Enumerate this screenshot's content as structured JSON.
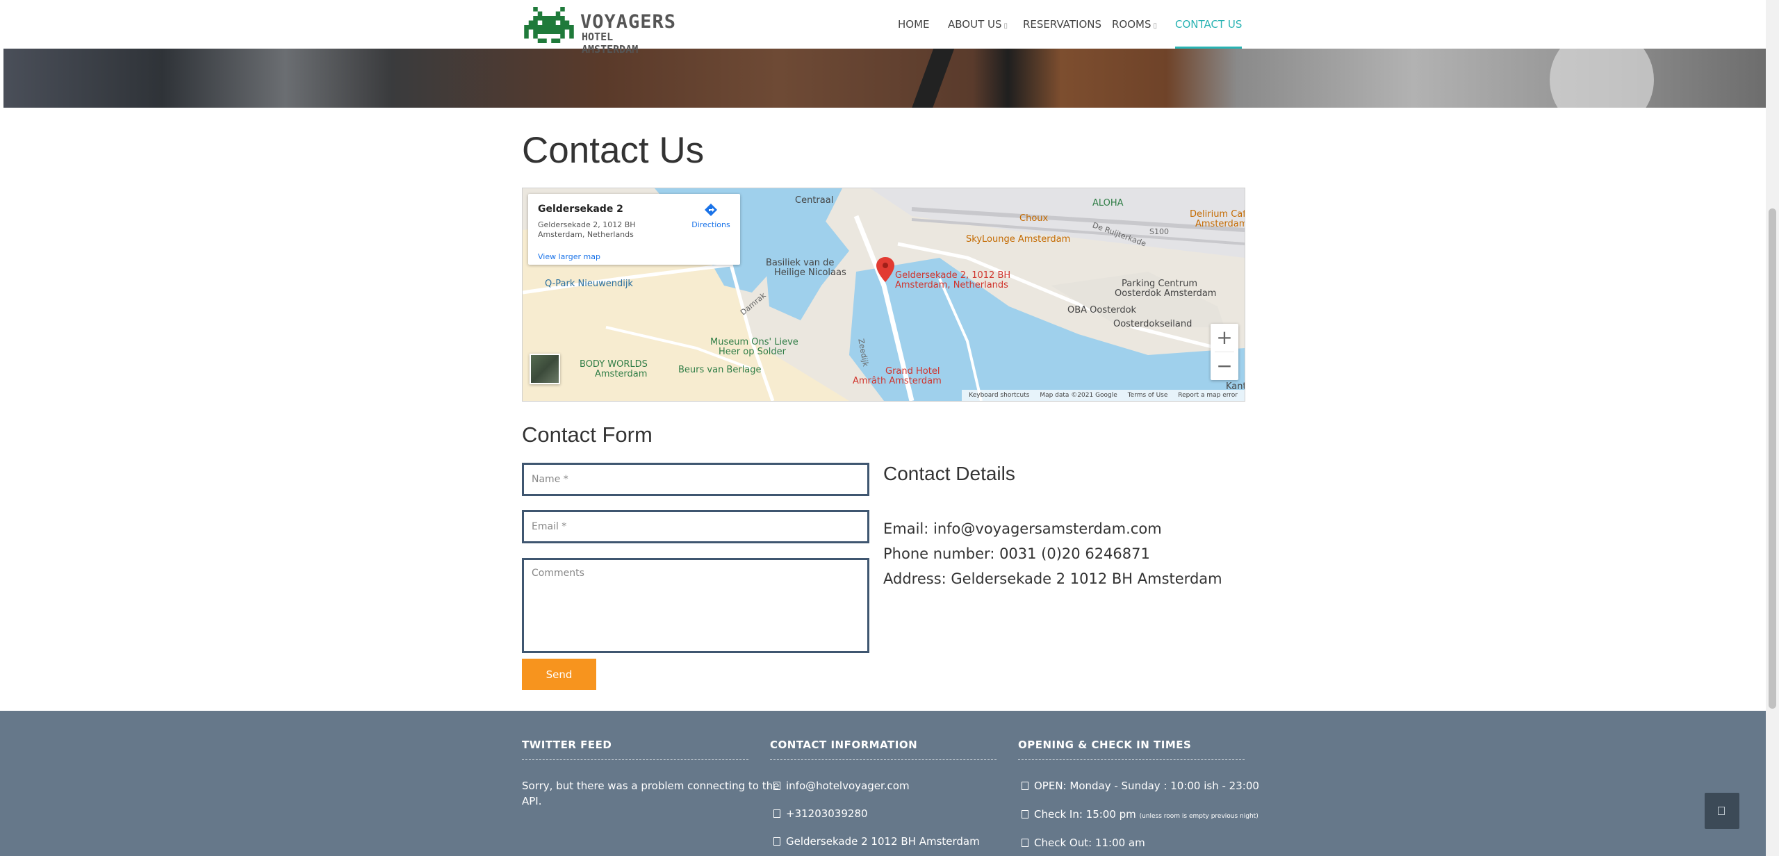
{
  "brand": {
    "name": "VOYAGERS",
    "subtitle": "HOTEL AMSTERDAM"
  },
  "nav": {
    "items": [
      {
        "label": "HOME",
        "caret": ""
      },
      {
        "label": "ABOUT US",
        "caret": "▯"
      },
      {
        "label": "RESERVATIONS",
        "caret": ""
      },
      {
        "label": "ROOMS",
        "caret": "▯"
      },
      {
        "label": "CONTACT US",
        "caret": ""
      }
    ],
    "active_label": "CONTACT US",
    "accent_color": "#29b3b3"
  },
  "page": {
    "title": "Contact Us"
  },
  "map": {
    "card": {
      "title": "Geldersekade 2",
      "address": "Geldersekade 2, 1012 BH Amsterdam, Netherlands",
      "larger_map": "View larger map",
      "directions": "Directions"
    },
    "pin_label_1": "Geldersekade 2, 1012 BH",
    "pin_label_2": "Amsterdam, Netherlands",
    "places": {
      "centraal": "Centraal",
      "aloha": "ALOHA",
      "choux": "Choux",
      "delirium": "Delirium Café",
      "delirium2": "Amsterdam",
      "skylounge": "SkyLounge Amsterdam",
      "basiliek1": "Basiliek van de",
      "basiliek2": "Heilige Nicolaas",
      "qpark": "Q-Park Nieuwendijk",
      "parking1": "Parking Centrum",
      "parking2": "Oosterdok Amsterdam",
      "oba": "OBA Oosterdok",
      "oosterdokseiland": "Oosterdokseiland",
      "museum1": "Museum Ons' Lieve",
      "museum2": "Heer op Solder",
      "bodyworlds1": "BODY WORLDS",
      "bodyworlds2": "Amsterdam",
      "beurs": "Beurs van Berlage",
      "grandhotel1": "Grand Hotel",
      "grandhotel2": "Amrâth Amsterdam",
      "damrak": "Damrak",
      "debuiksloot": "De Ruijterkade",
      "s100": "S100",
      "zeedijk": "Zeedijk",
      "kant": "Kant"
    },
    "zoom_in": "+",
    "zoom_out": "−",
    "attribution": {
      "shortcuts": "Keyboard shortcuts",
      "data": "Map data ©2021 Google",
      "terms": "Terms of Use",
      "report": "Report a map error"
    }
  },
  "contact_form": {
    "title": "Contact Form",
    "name_placeholder": "Name *",
    "email_placeholder": "Email *",
    "comments_placeholder": "Comments",
    "send_label": "Send",
    "send_color": "#f7941e"
  },
  "contact_details": {
    "title": "Contact Details",
    "email": "Email: info@voyagersamsterdam.com",
    "phone": "Phone number: 0031 (0)20 6246871",
    "address": "Address: Geldersekade 2 1012 BH Amsterdam"
  },
  "footer": {
    "twitter": {
      "heading": "TWITTER FEED",
      "line1": "Sorry, but there was a problem connecting to the",
      "line2": "API."
    },
    "contact": {
      "heading": "CONTACT INFORMATION",
      "email": "info@hotelvoyager.com",
      "phone": "+31203039280",
      "address": "Geldersekade 2 1012 BH Amsterdam"
    },
    "hours": {
      "heading": "OPENING & CHECK IN TIMES",
      "open": "OPEN: Monday - Sunday : 10:00 ish - 23:00",
      "checkin": "Check In: 15:00 pm",
      "checkin_note": "(unless room is empty previous night)",
      "checkout": "Check Out: 11:00 am"
    },
    "background": "#66788a"
  },
  "icons": {
    "back_to_top": "arrow-up-icon",
    "footer_email": "envelope-icon",
    "footer_phone": "phone-icon",
    "footer_address": "map-marker-icon",
    "footer_clock": "clock-icon"
  }
}
